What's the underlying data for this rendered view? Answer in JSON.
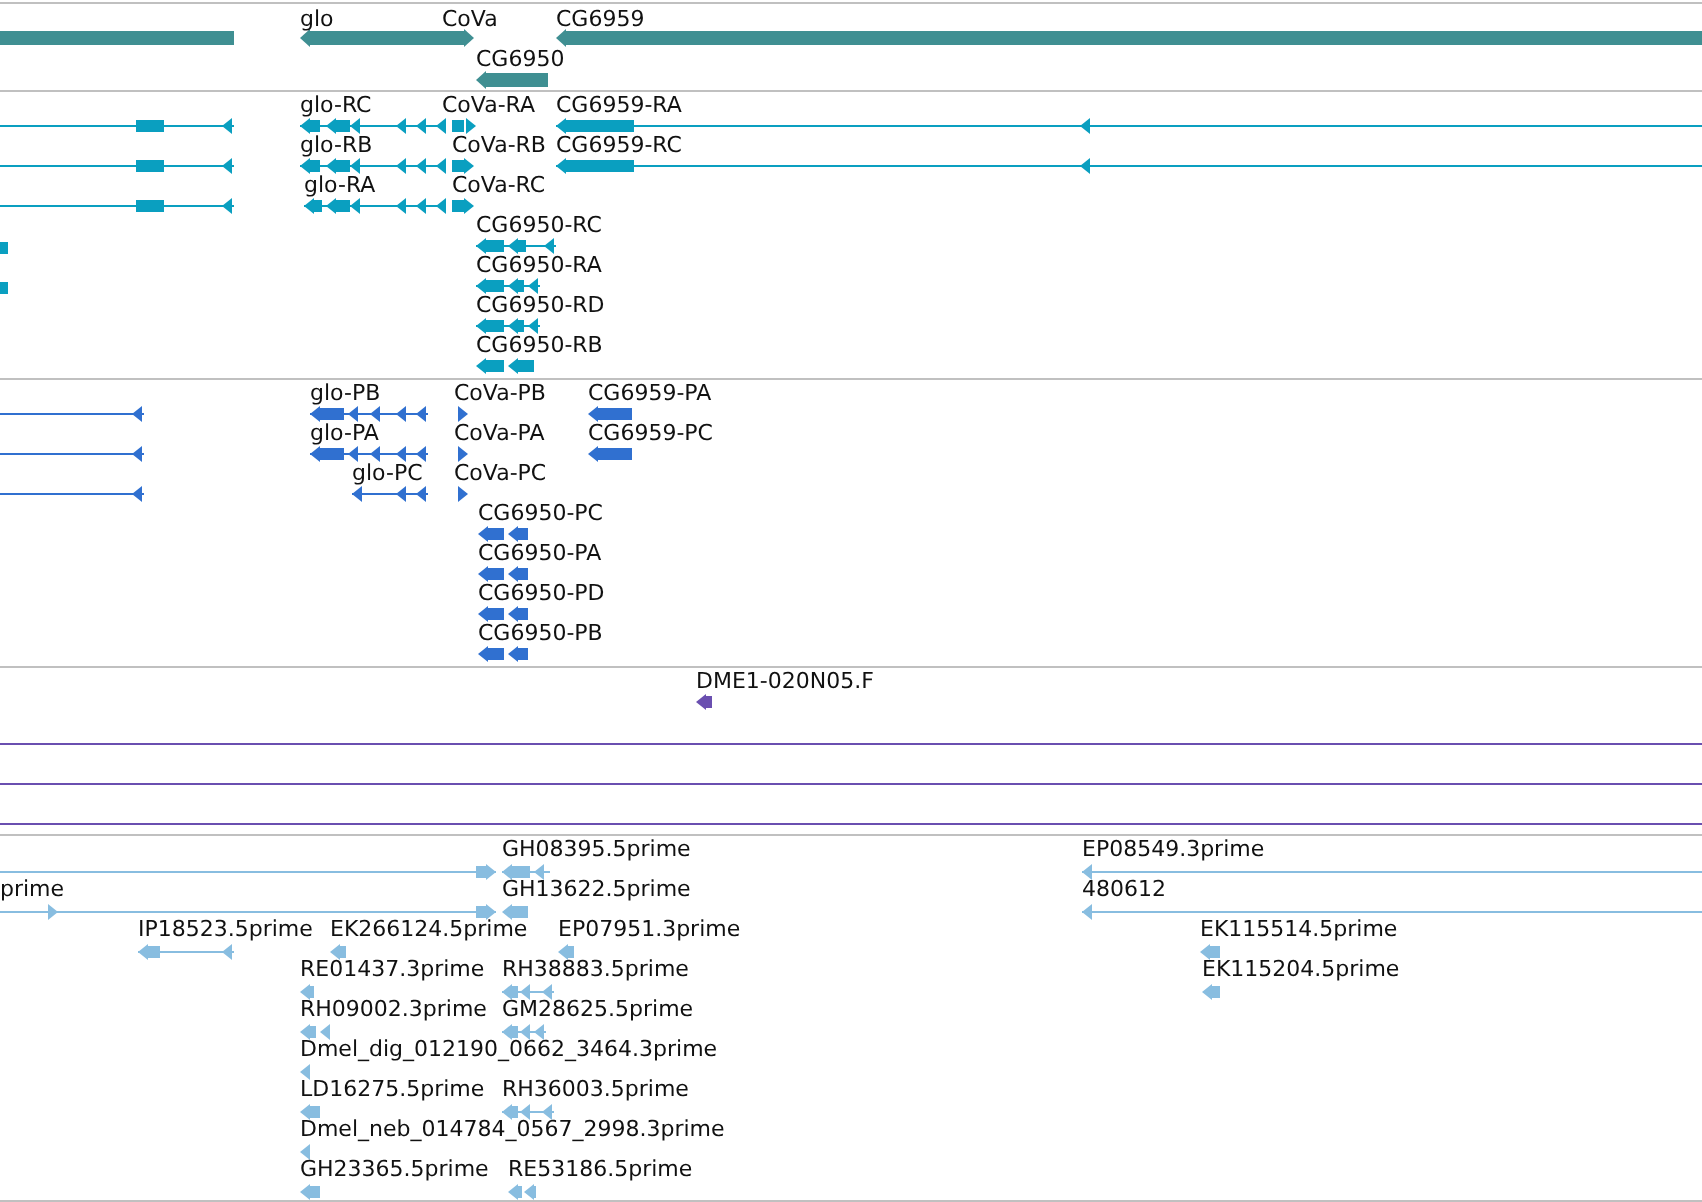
{
  "tracks": [
    {
      "color": "#3f8f92",
      "features": [
        {
          "label": "glo"
        },
        {
          "label": "CoVa"
        },
        {
          "label": "CG6959"
        },
        {
          "label": "CG6950"
        }
      ]
    },
    {
      "color": "#0a9fc0",
      "features": [
        {
          "label": "glo-RC"
        },
        {
          "label": "CoVa-RA"
        },
        {
          "label": "CG6959-RA"
        },
        {
          "label": "glo-RB"
        },
        {
          "label": "CoVa-RB"
        },
        {
          "label": "CG6959-RC"
        },
        {
          "label": "glo-RA"
        },
        {
          "label": "CoVa-RC"
        },
        {
          "label": "CG6950-RC"
        },
        {
          "label": "CG6950-RA"
        },
        {
          "label": "CG6950-RD"
        },
        {
          "label": "CG6950-RB"
        }
      ]
    },
    {
      "color": "#3070d0",
      "features": [
        {
          "label": "glo-PB"
        },
        {
          "label": "CoVa-PB"
        },
        {
          "label": "CG6959-PA"
        },
        {
          "label": "glo-PA"
        },
        {
          "label": "CoVa-PA"
        },
        {
          "label": "CG6959-PC"
        },
        {
          "label": "glo-PC"
        },
        {
          "label": "CoVa-PC"
        },
        {
          "label": "CG6950-PC"
        },
        {
          "label": "CG6950-PA"
        },
        {
          "label": "CG6950-PD"
        },
        {
          "label": "CG6950-PB"
        }
      ]
    },
    {
      "color": "#6a4fb0",
      "features": [
        {
          "label": "DME1-020N05.F"
        }
      ]
    },
    {
      "color": "#88bde0",
      "features": [
        {
          "label": "GH08395.5prime"
        },
        {
          "label": "EP08549.3prime"
        },
        {
          "label": "prime"
        },
        {
          "label": "GH13622.5prime"
        },
        {
          "label": "480612"
        },
        {
          "label": "IP18523.5prime"
        },
        {
          "label": "EK266124.5prime"
        },
        {
          "label": "EP07951.3prime"
        },
        {
          "label": "EK115514.5prime"
        },
        {
          "label": "RE01437.3prime"
        },
        {
          "label": "RH38883.5prime"
        },
        {
          "label": "EK115204.5prime"
        },
        {
          "label": "RH09002.3prime"
        },
        {
          "label": "GM28625.5prime"
        },
        {
          "label": "Dmel_dig_012190_0662_3464.3prime"
        },
        {
          "label": "LD16275.5prime"
        },
        {
          "label": "RH36003.5prime"
        },
        {
          "label": "Dmel_neb_014784_0567_2998.3prime"
        },
        {
          "label": "GH23365.5prime"
        },
        {
          "label": "RE53186.5prime"
        }
      ]
    }
  ]
}
